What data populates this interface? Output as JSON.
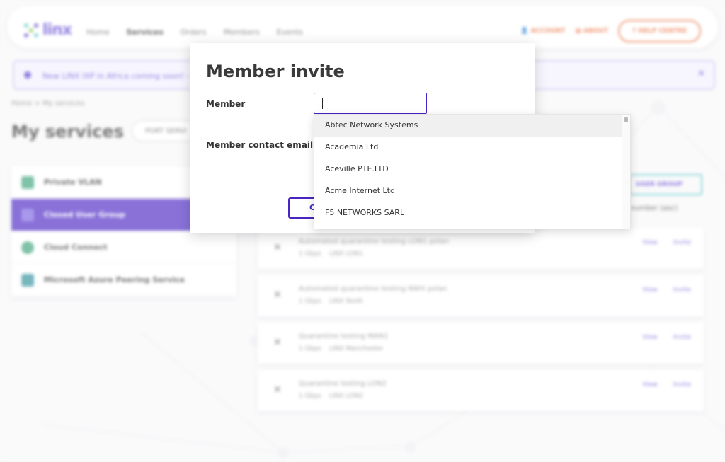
{
  "app": {
    "logo_text": "linx",
    "nav": [
      "Home",
      "Services",
      "Orders",
      "Members",
      "Events"
    ],
    "account_label": "ACCOUNT",
    "about_label": "ABOUT",
    "help_label": "HELP CENTRE"
  },
  "banner": {
    "text": "New LINX IXP in Africa coming soon! - F"
  },
  "breadcrumb": "Home > My services",
  "page_title": "My services",
  "port_services_label": "PORT SERVI",
  "sidebar": {
    "items": [
      {
        "label": "Private VLAN"
      },
      {
        "label": "Closed User Group"
      },
      {
        "label": "Cloud Connect"
      },
      {
        "label": "Microsoft Azure Peering Service"
      }
    ]
  },
  "user_group_button": "USER GROUP",
  "sort_label": "number (asc)",
  "cards": [
    {
      "name": "Automated quarantine testing LON1 polan",
      "speed": "1 Gbps",
      "location": "LINX LON1"
    },
    {
      "name": "Automated quarantine testing NWX polan",
      "speed": "1 Gbps",
      "location": "LINX NoVA"
    },
    {
      "name": "Quarantine testing MAN1",
      "speed": "1 Gbps",
      "location": "LINX Manchester"
    },
    {
      "name": "Quarantine testing LON2",
      "speed": "1 Gbps",
      "location": "LINX LON2"
    }
  ],
  "card_actions": {
    "view": "View",
    "invite": "Invite"
  },
  "modal": {
    "title": "Member invite",
    "member_label": "Member",
    "member_value": "",
    "email_label": "Member contact email",
    "cancel_label": "C"
  },
  "dropdown": {
    "options": [
      "Abtec Network Systems",
      "Academia Ltd",
      "Aceville PTE.LTD",
      "Acme Internet Ltd",
      "F5 NETWORKS SARL"
    ],
    "highlighted_index": 0
  },
  "colors": {
    "brand": "#4a25c4",
    "accent": "#e8622c"
  }
}
